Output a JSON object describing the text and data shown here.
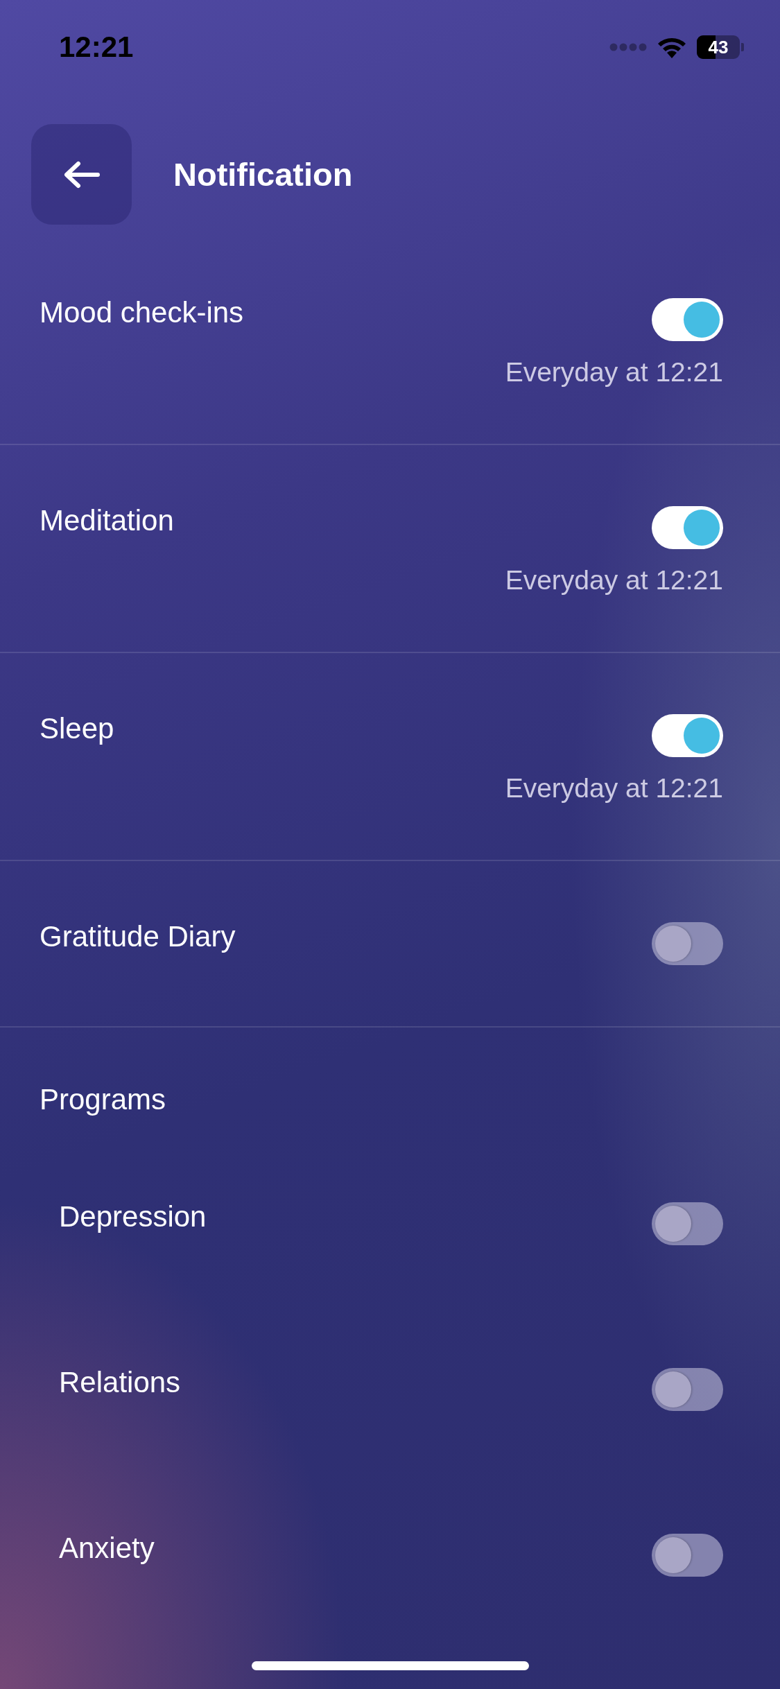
{
  "status_bar": {
    "time": "12:21",
    "battery": "43"
  },
  "header": {
    "title": "Notification"
  },
  "settings": [
    {
      "label": "Mood check-ins",
      "on": true,
      "schedule": "Everyday at 12:21"
    },
    {
      "label": "Meditation",
      "on": true,
      "schedule": "Everyday at 12:21"
    },
    {
      "label": "Sleep",
      "on": true,
      "schedule": "Everyday at 12:21"
    },
    {
      "label": "Gratitude Diary",
      "on": false
    }
  ],
  "programs": {
    "title": "Programs",
    "items": [
      {
        "label": "Depression",
        "on": false
      },
      {
        "label": "Relations",
        "on": false
      },
      {
        "label": "Anxiety",
        "on": false
      }
    ]
  }
}
